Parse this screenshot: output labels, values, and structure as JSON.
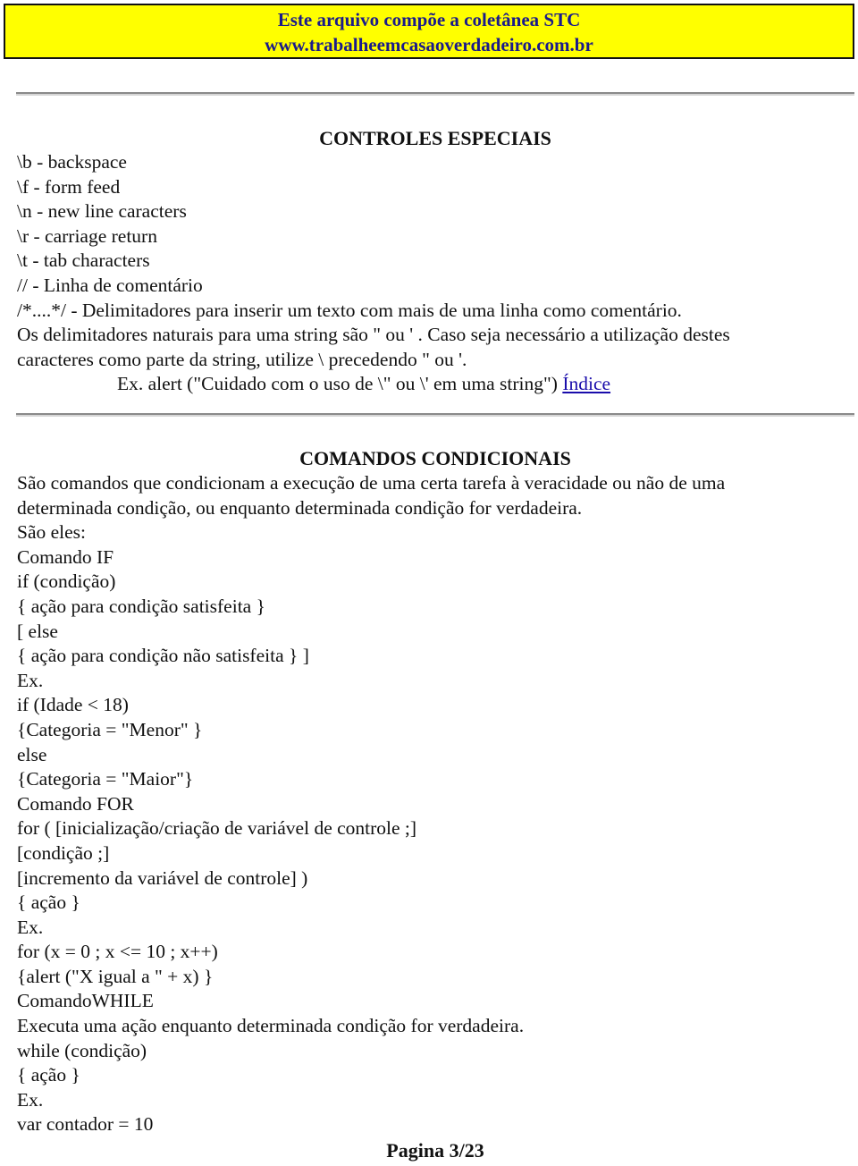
{
  "banner": {
    "line1": "Este arquivo compõe a coletânea STC",
    "line2": "www.trabalheemcasaoverdadeiro.com.br",
    "background_color": "#ffff00",
    "text_color": "#1a1a8c"
  },
  "section1": {
    "title": "CONTROLES ESPECIAIS",
    "lines": [
      "\\b - backspace",
      "\\f - form feed",
      "\\n - new line caracters",
      "\\r - carriage return",
      "\\t - tab characters",
      "// - Linha de comentário",
      "/*....*/ - Delimitadores para inserir um texto com mais de uma linha como comentário.",
      "Os delimitadores naturais para uma string são \" ou ' . Caso seja necessário a utilização destes",
      "caracteres como parte da string, utilize \\ precedendo \" ou '."
    ],
    "example": "Ex. alert (\"Cuidado com o uso de \\\" ou \\' em uma string\")",
    "index_link": "Índice"
  },
  "section2": {
    "title": "COMANDOS CONDICIONAIS",
    "lines": [
      "São comandos que condicionam a execução de uma certa tarefa à veracidade ou não de uma",
      "determinada condição, ou enquanto determinada condição for verdadeira.",
      "São eles:",
      "Comando IF",
      "if (condição)",
      "{ ação para condição satisfeita }",
      "[ else",
      "{ ação para condição não satisfeita } ]",
      "Ex.",
      "if (Idade < 18)",
      "{Categoria = \"Menor\" }",
      "else",
      "{Categoria = \"Maior\"}",
      "Comando FOR",
      "for ( [inicialização/criação de variável de controle ;]",
      "[condição ;]",
      "[incremento da variável de controle] )",
      "{ ação }",
      "Ex.",
      "for (x = 0 ; x <= 10 ; x++)",
      "{alert (\"X igual a \" + x) }",
      "ComandoWHILE",
      "Executa uma ação enquanto determinada condição for verdadeira.",
      "while (condição)",
      "{ ação }",
      "Ex.",
      "var contador = 10"
    ]
  },
  "footer": {
    "page_label": "Pagina 3/23",
    "current_page": 3,
    "total_pages": 23
  }
}
